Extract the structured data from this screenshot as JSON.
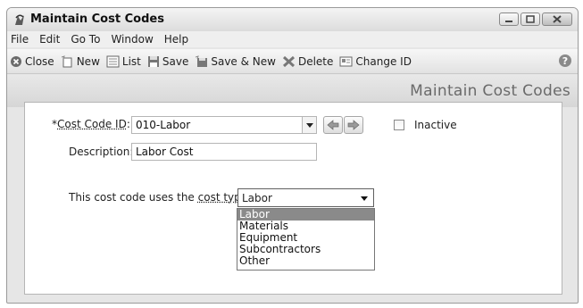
{
  "window": {
    "title": "Maintain Cost Codes"
  },
  "menu": [
    "File",
    "Edit",
    "Go To",
    "Window",
    "Help"
  ],
  "toolbar": {
    "close": "Close",
    "new": "New",
    "list": "List",
    "save": "Save",
    "save_new": "Save & New",
    "delete": "Delete",
    "change_id": "Change ID"
  },
  "page": {
    "title": "Maintain Cost Codes"
  },
  "form": {
    "cost_code_label_prefix": "*",
    "cost_code_label": "Cost Code ID",
    "cost_code_label_suffix": ":",
    "cost_code_value": "010-Labor",
    "inactive_label": "Inactive",
    "description_label": "Description:",
    "description_value": "Labor Cost",
    "cost_type_sentence": "This cost code uses the",
    "cost_type_link": "cost type",
    "cost_type_selected": "Labor",
    "cost_type_options": [
      "Labor",
      "Materials",
      "Equipment",
      "Subcontractors",
      "Other"
    ]
  },
  "colors": {
    "selected_option_bg": "#8a8a8a",
    "page_title": "#6a6a6a"
  }
}
